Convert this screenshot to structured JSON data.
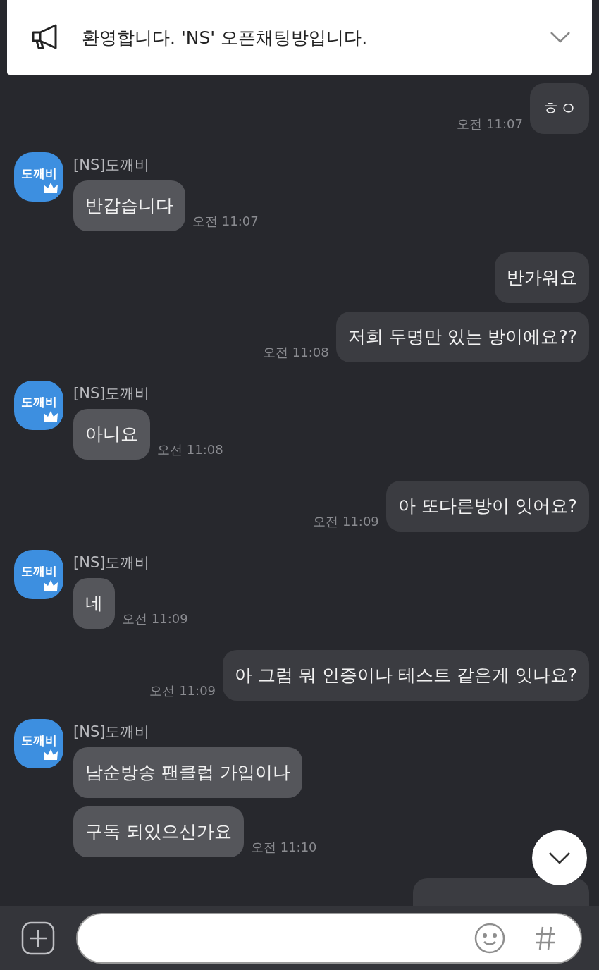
{
  "notice": {
    "text": "환영합니다. 'NS' 오픈채팅방입니다."
  },
  "groups": [
    {
      "kind": "sent",
      "bubbles": [
        {
          "text": "ㅎㅇ",
          "time": "오전 11:07"
        }
      ]
    },
    {
      "kind": "received",
      "sender": "[NS]도깨비",
      "avatar_label": "도깨비",
      "bubbles": [
        {
          "text": "반갑습니다",
          "time": "오전 11:07"
        }
      ]
    },
    {
      "kind": "sent",
      "bubbles": [
        {
          "text": "반가워요"
        },
        {
          "text": "저희 두명만 있는 방이에요??",
          "time": "오전 11:08"
        }
      ]
    },
    {
      "kind": "received",
      "sender": "[NS]도깨비",
      "avatar_label": "도깨비",
      "bubbles": [
        {
          "text": "아니요",
          "time": "오전 11:08"
        }
      ]
    },
    {
      "kind": "sent",
      "bubbles": [
        {
          "text": "아 또다른방이 잇어요?",
          "time": "오전 11:09"
        }
      ]
    },
    {
      "kind": "received",
      "sender": "[NS]도깨비",
      "avatar_label": "도깨비",
      "bubbles": [
        {
          "text": "네",
          "time": "오전 11:09"
        }
      ]
    },
    {
      "kind": "sent",
      "bubbles": [
        {
          "text": "아 그럼 뭐 인증이나 테스트 같은게 잇나요?",
          "time": "오전 11:09"
        }
      ]
    },
    {
      "kind": "received",
      "sender": "[NS]도깨비",
      "avatar_label": "도깨비",
      "bubbles": [
        {
          "text": "남순방송 팬클럽 가입이나"
        },
        {
          "text": "구독 되있으신가요",
          "time": "오전 11:10"
        }
      ]
    },
    {
      "kind": "sent_cut_off"
    }
  ]
}
